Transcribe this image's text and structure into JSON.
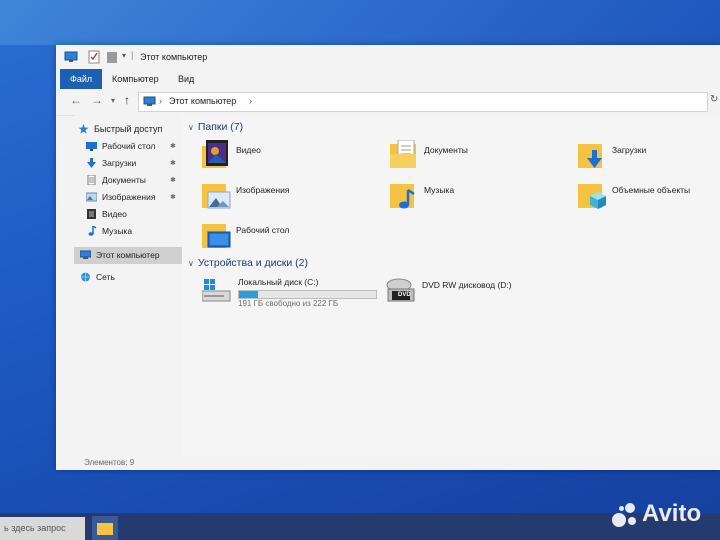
{
  "window": {
    "title": "Этот компьютер",
    "tabs": [
      "Файл",
      "Компьютер",
      "Вид"
    ],
    "address_path": "Этот компьютер"
  },
  "sidebar": {
    "quick_access": "Быстрый доступ",
    "items": [
      {
        "label": "Рабочий стол",
        "icon": "desktop-icon",
        "pinned": true
      },
      {
        "label": "Загрузки",
        "icon": "downloads-icon",
        "pinned": true
      },
      {
        "label": "Документы",
        "icon": "documents-icon",
        "pinned": true
      },
      {
        "label": "Изображения",
        "icon": "pictures-icon",
        "pinned": true
      },
      {
        "label": "Видео",
        "icon": "video-icon",
        "pinned": false
      },
      {
        "label": "Музыка",
        "icon": "music-icon",
        "pinned": false
      }
    ],
    "this_pc": "Этот компьютер",
    "network": "Сеть",
    "pin_glyph": "✱"
  },
  "folders_section": {
    "title": "Папки (7)",
    "items": [
      {
        "label": "Видео",
        "icon": "video-folder-icon"
      },
      {
        "label": "Документы",
        "icon": "documents-folder-icon"
      },
      {
        "label": "Загрузки",
        "icon": "downloads-folder-icon"
      },
      {
        "label": "Изображения",
        "icon": "pictures-folder-icon"
      },
      {
        "label": "Музыка",
        "icon": "music-folder-icon"
      },
      {
        "label": "Объемные объекты",
        "icon": "3d-objects-folder-icon"
      },
      {
        "label": "Рабочий стол",
        "icon": "desktop-folder-icon"
      }
    ]
  },
  "drives_section": {
    "title": "Устройства и диски (2)",
    "drives": [
      {
        "label": "Локальный диск (C:)",
        "free": "191 ГБ свободно из 222 ГБ",
        "used_fraction": 0.14,
        "icon": "windows-drive-icon"
      },
      {
        "label": "DVD RW дисковод (D:)",
        "icon": "dvd-drive-icon",
        "badge": "DVD"
      }
    ]
  },
  "status": {
    "items_count": "Элементов: 9"
  },
  "taskbar": {
    "search_placeholder": "ь здесь запрос"
  },
  "watermark": {
    "text": "Avito"
  },
  "colors": {
    "accent": "#1c5fb3",
    "folder": "#f5c242",
    "drive_bar": "#26a0da"
  }
}
